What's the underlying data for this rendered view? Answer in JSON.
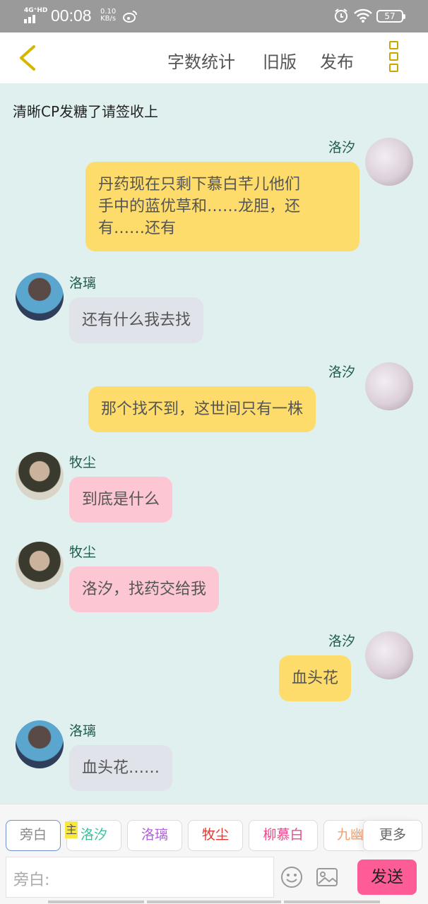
{
  "status": {
    "net": "4G⁺HD",
    "time": "00:08",
    "speed_value": "0.10",
    "speed_unit": "KB/s",
    "battery": "57"
  },
  "toolbar": {
    "word_count": "字数统计",
    "old_version": "旧版",
    "publish": "发布"
  },
  "chat_title": "清晰CP发糖了请签收上",
  "messages": [
    {
      "side": "right",
      "name": "洛汐",
      "text_lines": [
        "丹药现在只剩下慕白芊儿他们",
        "手中的蓝优草和……龙胆，还",
        "有……还有"
      ],
      "color": "#fddc6c"
    },
    {
      "side": "left",
      "name": "洛璃",
      "text": "还有什么我去找",
      "color": "#e0e4ea"
    },
    {
      "side": "right",
      "name": "洛汐",
      "text": "那个找不到，这世间只有一株",
      "color": "#fddc6c"
    },
    {
      "side": "left",
      "name": "牧尘",
      "text": "到底是什么",
      "color": "#fcc7d2"
    },
    {
      "side": "left",
      "name": "牧尘",
      "text": "洛汐，找药交给我",
      "color": "#fcc7d2"
    },
    {
      "side": "right",
      "name": "洛汐",
      "text": "血头花",
      "color": "#fddc6c"
    },
    {
      "side": "left",
      "name": "洛璃",
      "text": "血头花……",
      "color": "#e0e4ea"
    }
  ],
  "roles": [
    {
      "label": "旁白",
      "color": "#888888",
      "selected": true
    },
    {
      "label": "洛汐",
      "color": "#3cbf9b",
      "main_badge": "主"
    },
    {
      "label": "洛璃",
      "color": "#b062d9"
    },
    {
      "label": "牧尘",
      "color": "#e0382f"
    },
    {
      "label": "柳慕白",
      "color": "#e84a8a"
    },
    {
      "label": "九幽",
      "color": "#f0a070"
    }
  ],
  "more": "更多",
  "input": {
    "placeholder": "旁白:"
  },
  "send": "发送",
  "icons": [
    "signal-icon",
    "weibo-icon",
    "alarm-icon",
    "wifi-icon",
    "battery-icon",
    "back-icon",
    "more-menu-icon",
    "emoji-icon",
    "image-icon"
  ]
}
